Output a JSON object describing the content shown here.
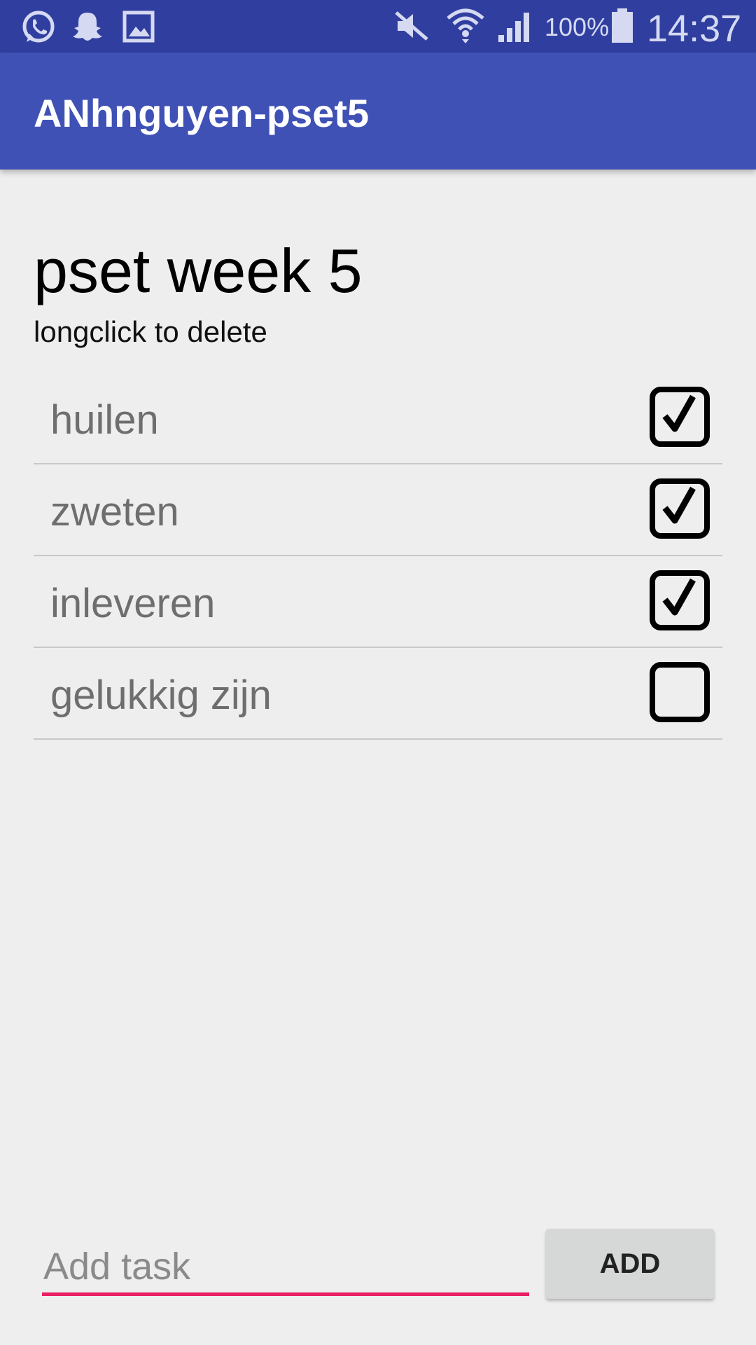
{
  "status_bar": {
    "left_icons": [
      "whatsapp-icon",
      "snapchat-icon",
      "gallery-icon"
    ],
    "right_icons": [
      "mute-icon",
      "wifi-icon",
      "signal-icon",
      "battery-icon"
    ],
    "battery": "100%",
    "time": "14:37"
  },
  "app_bar": {
    "title": "ANhnguyen-pset5"
  },
  "list": {
    "title": "pset week 5",
    "hint": "longclick to delete",
    "tasks": [
      {
        "label": "huilen",
        "checked": true
      },
      {
        "label": "zweten",
        "checked": true
      },
      {
        "label": "inleveren",
        "checked": true
      },
      {
        "label": "gelukkig zijn",
        "checked": false
      }
    ]
  },
  "composer": {
    "input_value": "",
    "input_placeholder": "Add task",
    "add_label": "ADD"
  },
  "colors": {
    "status_bar": "#303f9f",
    "app_bar": "#3f51b5",
    "accent": "#e91e63",
    "background": "#eeeeee"
  }
}
